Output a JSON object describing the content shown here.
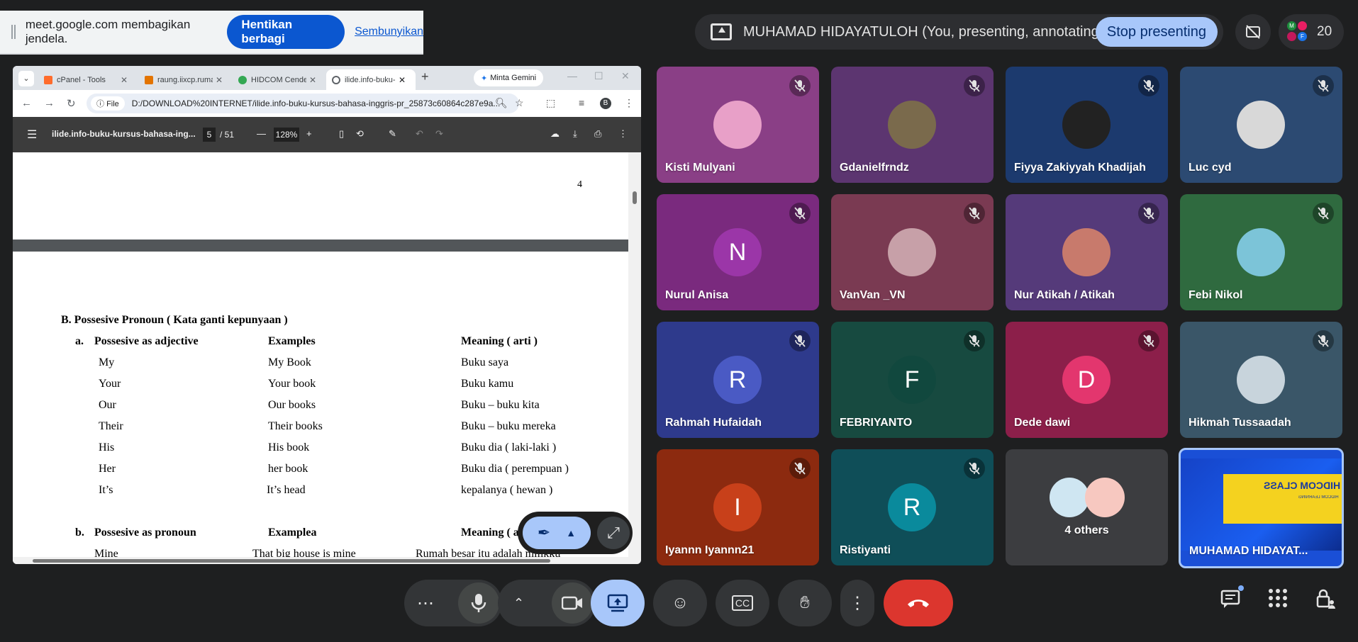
{
  "share_notice": {
    "message": "meet.google.com membagikan jendela.",
    "stop_label": "Hentikan berbagi",
    "hide_label": "Sembunyikan"
  },
  "presenting": {
    "text": "MUHAMAD HIDAYATULOH (You, presenting, annotating)",
    "stop_label": "Stop presenting"
  },
  "participants_count": "20",
  "people_chip_letters": [
    "M",
    "F"
  ],
  "browser": {
    "tabs": [
      {
        "title": "cPanel - Tools",
        "favicon_color": "#ff6c2c"
      },
      {
        "title": "raung.iixcp.rumah",
        "favicon_color": "#e37400"
      },
      {
        "title": "HIDCOM Cendekia",
        "favicon_color": "#34a853"
      },
      {
        "title": "ilide.info-buku-kursus",
        "favicon_color": "#5f6368"
      }
    ],
    "gemini_label": "Minta Gemini",
    "file_chip": "File",
    "url": "D:/DOWNLOAD%20INTERNET/ilide.info-buku-kursus-bahasa-inggris-pr_25873c60864c287e9a...",
    "profile_letter": "B"
  },
  "pdf": {
    "filename": "ilide.info-buku-kursus-bahasa-ing...",
    "page_current": "5",
    "page_total": "/ 51",
    "zoom": "128%",
    "prev_page_number": "4",
    "heading": "B. Possesive Pronoun ( Kata ganti kepunyaan )",
    "section_a": {
      "label": "a.",
      "col1": "Possesive as adjective",
      "col2": "Examples",
      "col3": "Meaning ( arti )"
    },
    "rows": [
      [
        "My",
        "My Book",
        "Buku saya"
      ],
      [
        "Your",
        "Your book",
        "Buku kamu"
      ],
      [
        "Our",
        "Our books",
        "Buku – buku kita"
      ],
      [
        "Their",
        "Their books",
        "Buku – buku mereka"
      ],
      [
        "His",
        "His book",
        "Buku dia ( laki-laki )"
      ],
      [
        "Her",
        "her book",
        "Buku dia ( perempuan )"
      ],
      [
        "It’s",
        "It’s head",
        "kepalanya ( hewan )"
      ]
    ],
    "section_b": {
      "label": "b.",
      "col1": "Possesive as pronoun",
      "col2": "Examplea",
      "col3": "Meaning ( arti )"
    },
    "row_b1": [
      "Mine",
      "That big house is mine",
      "Rumah besar itu adalah milikku"
    ]
  },
  "tiles": [
    {
      "name": "Kisti Mulyani",
      "bg": "#8a3f86",
      "avatar": "",
      "avatar_color": "#e8a0c8"
    },
    {
      "name": "Gdanielfrndz",
      "bg": "#5c3570",
      "avatar": "",
      "avatar_color": "#7a6a4c"
    },
    {
      "name": "Fiyya Zakiyyah Khadijah",
      "bg": "#1c3a6e",
      "avatar": "",
      "avatar_color": "#222222"
    },
    {
      "name": "Luc cyd",
      "bg": "#2c4a72",
      "avatar": "",
      "avatar_color": "#d8d8d8"
    },
    {
      "name": "Nurul Anisa",
      "bg": "#7a2a7e",
      "avatar": "N",
      "avatar_color": "#9b36a8"
    },
    {
      "name": "VanVan _VN",
      "bg": "#7a3a52",
      "avatar": "",
      "avatar_color": "#c7a0a8"
    },
    {
      "name": "Nur Atikah / Atikah",
      "bg": "#553a7a",
      "avatar": "",
      "avatar_color": "#c87a6c"
    },
    {
      "name": "Febi Nikol",
      "bg": "#2f6a3f",
      "avatar": "",
      "avatar_color": "#7cc4d8"
    },
    {
      "name": "Rahmah Hufaidah",
      "bg": "#2e3a8c",
      "avatar": "R",
      "avatar_color": "#4a5ac4"
    },
    {
      "name": "FEBRIYANTO",
      "bg": "#174a40",
      "avatar": "F",
      "avatar_color": "#11483e"
    },
    {
      "name": "Dede dawi",
      "bg": "#8c1f4a",
      "avatar": "D",
      "avatar_color": "#e3366e"
    },
    {
      "name": "Hikmah Tussaadah",
      "bg": "#3a5668",
      "avatar": "",
      "avatar_color": "#c8d4dc"
    },
    {
      "name": "Iyannn Iyannn21",
      "bg": "#8c2a0f",
      "avatar": "I",
      "avatar_color": "#c8401a"
    },
    {
      "name": "Ristiyanti",
      "bg": "#0f4e58",
      "avatar": "R",
      "avatar_color": "#0a8a9c"
    },
    {
      "name": "4 others",
      "bg": "#3c3d40",
      "avatar": "",
      "avatar_color": "#d8e8f0"
    },
    {
      "name": "MUHAMAD HIDAYAT...",
      "bg": "#1a4fd6",
      "avatar": "",
      "avatar_color": "#1a4fd6",
      "slide_title": "HIDCOM CLASS",
      "slide_sub": "HIDCOM LEARNING"
    }
  ],
  "colors": {
    "accent": "#a8c7fa",
    "end_call": "#dc362e",
    "share_blue": "#0b57d0"
  }
}
